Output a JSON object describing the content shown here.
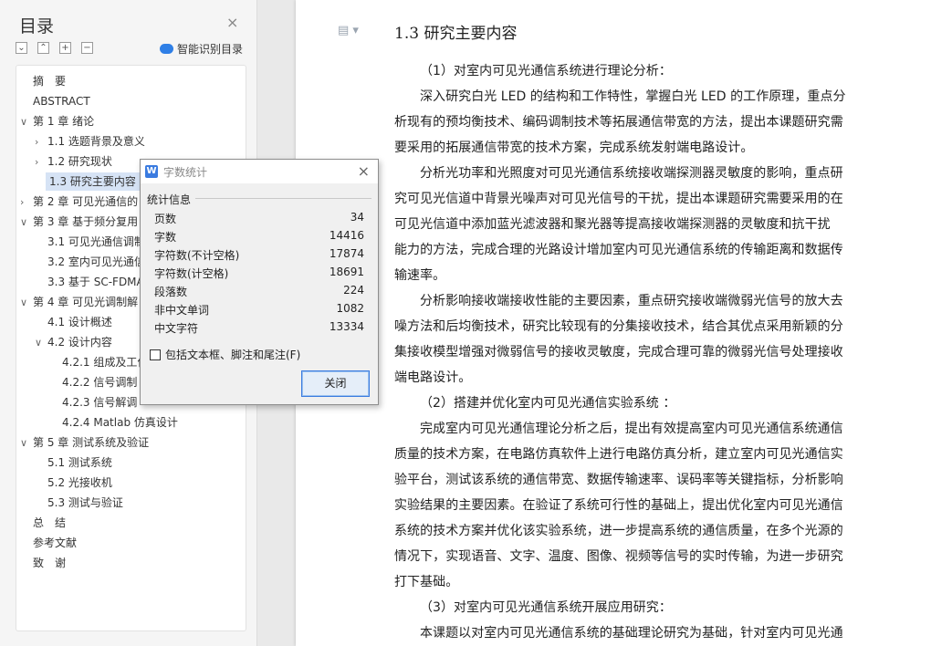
{
  "toc": {
    "title": "目录",
    "close_glyph": "×",
    "smart_label": "智能识别目录",
    "items": [
      {
        "arrow": "",
        "label": "摘　要",
        "level": 0
      },
      {
        "arrow": "",
        "label": "ABSTRACT",
        "level": 0
      },
      {
        "arrow": "∨",
        "label": "第 1 章  绪论",
        "level": 0
      },
      {
        "arrow": "›",
        "label": "1.1 选题背景及意义",
        "level": 1
      },
      {
        "arrow": "›",
        "label": "1.2 研究现状",
        "level": 1
      },
      {
        "arrow": "",
        "label": "1.3 研究主要内容",
        "level": 1,
        "active": true
      },
      {
        "arrow": "›",
        "label": "第 2 章  可见光通信的",
        "level": 0
      },
      {
        "arrow": "∨",
        "label": "第 3 章  基于频分复用",
        "level": 0
      },
      {
        "arrow": "",
        "label": "3.1  可见光通信调制",
        "level": 1
      },
      {
        "arrow": "",
        "label": "3.2  室内可见光通信",
        "level": 1
      },
      {
        "arrow": "",
        "label": "3.3  基于 SC-FDMA",
        "level": 1
      },
      {
        "arrow": "∨",
        "label": "第 4 章  可见光调制解",
        "level": 0
      },
      {
        "arrow": "",
        "label": "4.1 设计概述",
        "level": 1
      },
      {
        "arrow": "∨",
        "label": "4.2 设计内容",
        "level": 1
      },
      {
        "arrow": "",
        "label": "4.2.1 组成及工作",
        "level": 2
      },
      {
        "arrow": "",
        "label": "4.2.2 信号调制",
        "level": 2
      },
      {
        "arrow": "",
        "label": "4.2.3 信号解调",
        "level": 2
      },
      {
        "arrow": "",
        "label": "4.2.4 Matlab 仿真设计",
        "level": 2
      },
      {
        "arrow": "∨",
        "label": "第 5 章  测试系统及验证",
        "level": 0
      },
      {
        "arrow": "",
        "label": "5.1 测试系统",
        "level": 1
      },
      {
        "arrow": "",
        "label": "5.2 光接收机",
        "level": 1
      },
      {
        "arrow": "",
        "label": "5.3 测试与验证",
        "level": 1
      },
      {
        "arrow": "",
        "label": "总　结",
        "level": 0
      },
      {
        "arrow": "",
        "label": "参考文献",
        "level": 0
      },
      {
        "arrow": "",
        "label": "致　谢",
        "level": 0
      }
    ]
  },
  "document": {
    "heading": "1.3 研究主要内容",
    "lines": [
      "（1）对室内可见光通信系统进行理论分析：",
      "深入研究白光 LED 的结构和工作特性，掌握白光 LED 的工作原理，重点分",
      "析现有的预均衡技术、编码调制技术等拓展通信带宽的方法，提出本课题研究需",
      "要采用的拓展通信带宽的技术方案，完成系统发射端电路设计。",
      "分析光功率和光照度对可见光通信系统接收端探测器灵敏度的影响，重点研",
      "究可见光信道中背景光噪声对可见光信号的干扰，提出本课题研究需要采用的在",
      "可见光信道中添加蓝光滤波器和聚光器等提高接收端探测器的灵敏度和抗干扰",
      "能力的方法，完成合理的光路设计增加室内可见光通信系统的传输距离和数据传",
      "输速率。",
      "分析影响接收端接收性能的主要因素，重点研究接收端微弱光信号的放大去",
      "噪方法和后均衡技术，研究比较现有的分集接收技术，结合其优点采用新颖的分",
      "集接收模型增强对微弱信号的接收灵敏度，完成合理可靠的微弱光信号处理接收",
      "端电路设计。",
      "（2）搭建并优化室内可见光通信实验系统  ：",
      "完成室内可见光通信理论分析之后，提出有效提高室内可见光通信系统通信",
      "质量的技术方案，在电路仿真软件上进行电路仿真分析，建立室内可见光通信实",
      "验平台，测试该系统的通信带宽、数据传输速率、误码率等关键指标，分析影响",
      "实验结果的主要因素。在验证了系统可行性的基础上，提出优化室内可见光通信",
      "系统的技术方案并优化该实验系统，进一步提高系统的通信质量，在多个光源的",
      "情况下，实现语音、文字、温度、图像、视频等信号的实时传输，为进一步研究",
      "打下基础。",
      "（3）对室内可见光通信系统开展应用研究：",
      "本课题以对室内可见光通信系统的基础理论研究为基础，针对室内可见光通"
    ]
  },
  "dialog": {
    "title": "字数统计",
    "close_glyph": "×",
    "section_label": "统计信息",
    "stats": [
      {
        "label": "页数",
        "value": "34"
      },
      {
        "label": "字数",
        "value": "14416"
      },
      {
        "label": "字符数(不计空格)",
        "value": "17874"
      },
      {
        "label": "字符数(计空格)",
        "value": "18691"
      },
      {
        "label": "段落数",
        "value": "224"
      },
      {
        "label": "非中文单词",
        "value": "1082"
      },
      {
        "label": "中文字符",
        "value": "13334"
      }
    ],
    "checkbox_label": "包括文本框、脚注和尾注(F)",
    "checkbox_checked": false,
    "close_button": "关闭"
  }
}
